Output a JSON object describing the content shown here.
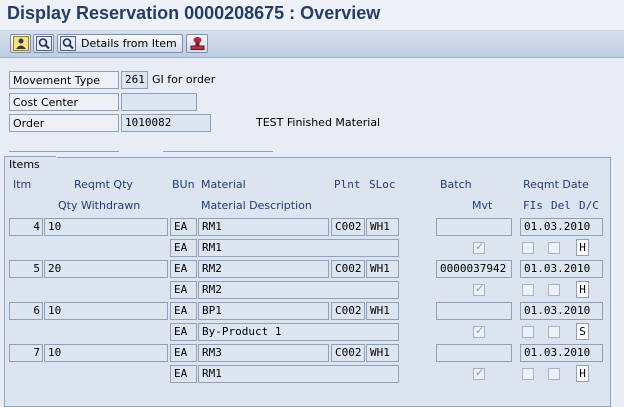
{
  "title": "Display Reservation 0000208675 : Overview",
  "toolbar": {
    "details_label": "Details from Item"
  },
  "header": {
    "movement_type_label": "Movement Type",
    "movement_type_value": "261",
    "movement_type_text": "GI for order",
    "cost_center_label": "Cost Center",
    "cost_center_value": "",
    "order_label": "Order",
    "order_value": "1010082",
    "order_text": "TEST Finished Material"
  },
  "items": {
    "tab_label": "Items",
    "columns": {
      "itm": "Itm",
      "reqmt_qty": "Reqmt Qty",
      "bun": "BUn",
      "material": "Material",
      "plnt": "Plnt",
      "sloc": "SLoc",
      "batch": "Batch",
      "reqmt_date": "Reqmt Date",
      "qty_withdrawn": "Qty Withdrawn",
      "material_description": "Material Description",
      "mvt": "Mvt",
      "fis": "FIs",
      "del": "Del",
      "dc": "D/C"
    },
    "rows": [
      {
        "itm": "4",
        "qty": "10",
        "bun": "EA",
        "material": "RM1",
        "plnt": "C002",
        "sloc": "WH1",
        "batch": "",
        "date": "01.03.2010",
        "bun2": "EA",
        "desc": "RM1",
        "mvt": true,
        "fis": false,
        "del": false,
        "dc": "H"
      },
      {
        "itm": "5",
        "qty": "20",
        "bun": "EA",
        "material": "RM2",
        "plnt": "C002",
        "sloc": "WH1",
        "batch": "0000037942",
        "date": "01.03.2010",
        "bun2": "EA",
        "desc": "RM2",
        "mvt": true,
        "fis": false,
        "del": false,
        "dc": "H"
      },
      {
        "itm": "6",
        "qty": "10",
        "bun": "EA",
        "material": "BP1",
        "plnt": "C002",
        "sloc": "WH1",
        "batch": "",
        "date": "01.03.2010",
        "bun2": "EA",
        "desc": "By-Product 1",
        "mvt": true,
        "fis": false,
        "del": false,
        "dc": "S"
      },
      {
        "itm": "7",
        "qty": "10",
        "bun": "EA",
        "material": "RM3",
        "plnt": "C002",
        "sloc": "WH1",
        "batch": "",
        "date": "01.03.2010",
        "bun2": "EA",
        "desc": "RM1",
        "mvt": true,
        "fis": false,
        "del": false,
        "dc": "H"
      }
    ]
  },
  "icons": [
    "person-icon",
    "find-icon",
    "details-icon",
    "stamp-icon"
  ],
  "colors": {
    "title_text": "#243d66",
    "header_text": "#1f3b78",
    "background": "#e7ecf5"
  }
}
